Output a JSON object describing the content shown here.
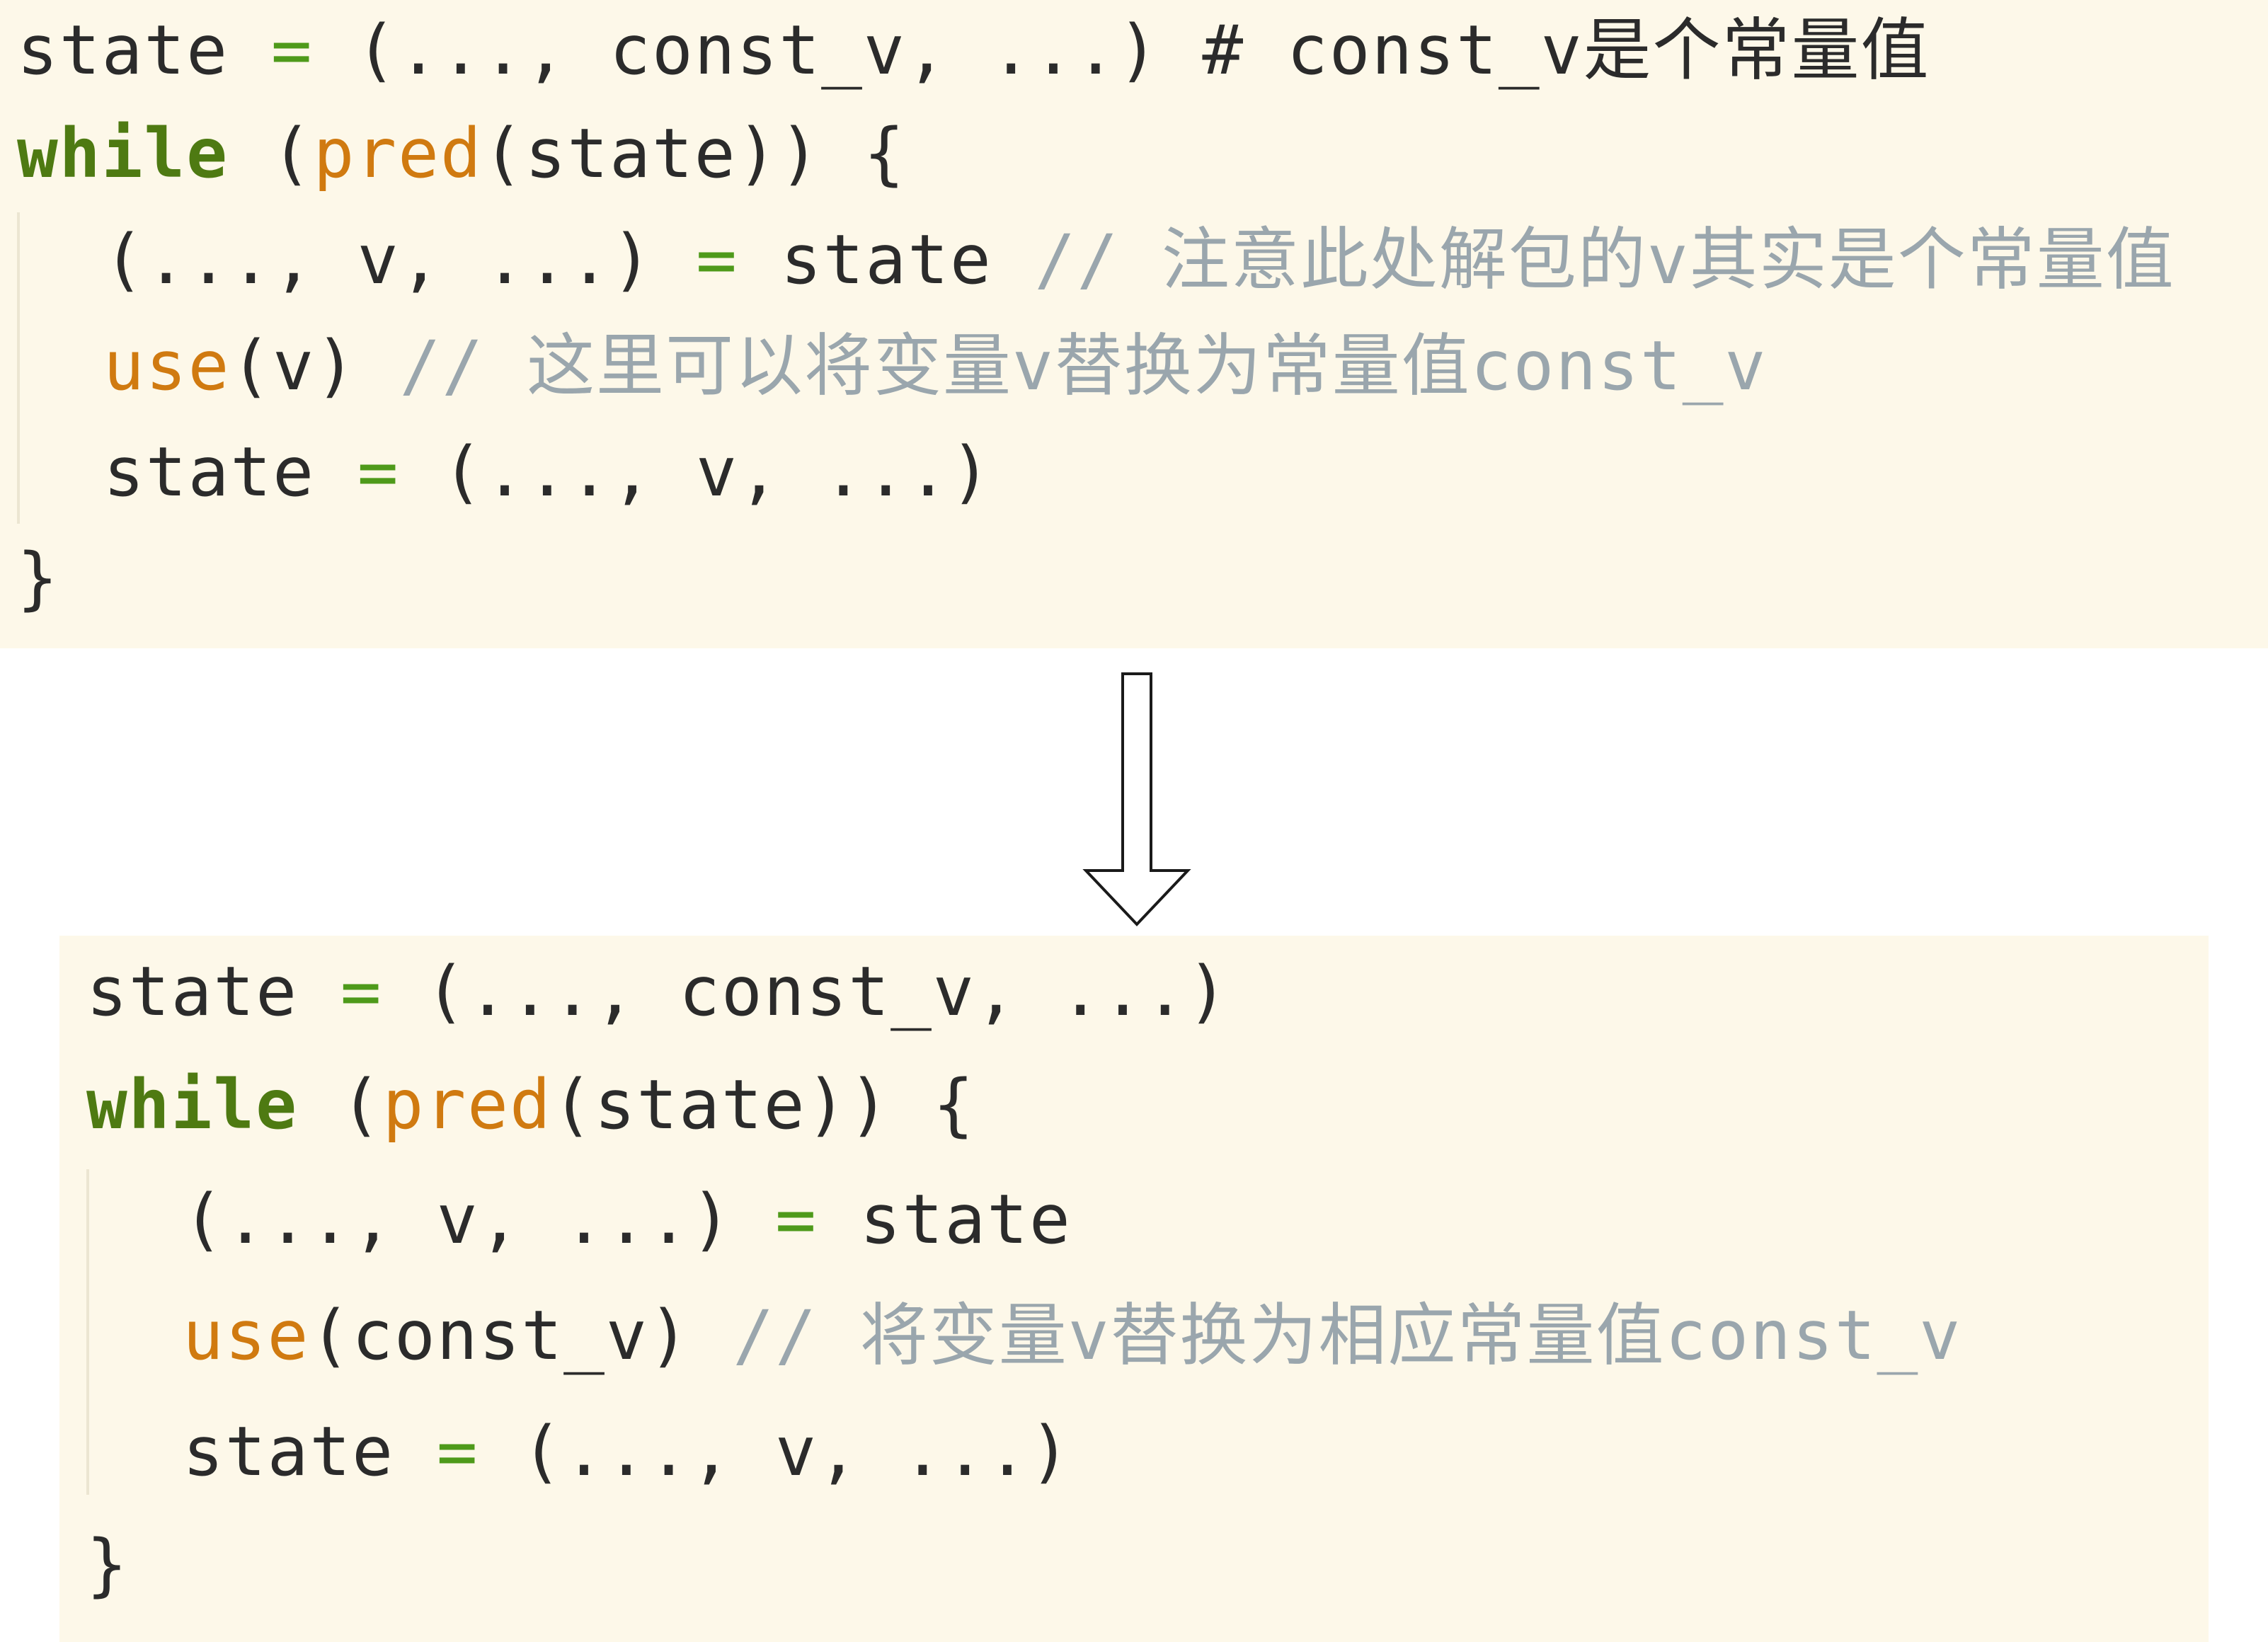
{
  "top_block": {
    "line1": {
      "a": "state",
      "op": "=",
      "b": "(..., const_v, ...)",
      "comment": "# const_v是个常量值"
    },
    "line2": {
      "kw": "while",
      "b1": "(",
      "fn": "pred",
      "b2": "(state)) {"
    },
    "line3": {
      "a": "(..., v, ...)",
      "op": "=",
      "b": "state",
      "comment": "// 注意此处解包的v其实是个常量值"
    },
    "line4": {
      "fn": "use",
      "b": "(v)",
      "comment": "// 这里可以将变量v替换为常量值const_v"
    },
    "line5": {
      "a": "state",
      "op": "=",
      "b": "(..., v, ...)"
    },
    "line6": {
      "a": "}"
    }
  },
  "bottom_block": {
    "line1": {
      "a": "state",
      "op": "=",
      "b": "(..., const_v, ...)"
    },
    "line2": {
      "kw": "while",
      "b1": "(",
      "fn": "pred",
      "b2": "(state)) {"
    },
    "line3": {
      "a": "(..., v, ...)",
      "op": "=",
      "b": "state"
    },
    "line4": {
      "fn": "use",
      "b": "(const_v)",
      "comment": "// 将变量v替换为相应常量值const_v"
    },
    "line5": {
      "a": "state",
      "op": "=",
      "b": "(..., v, ...)"
    },
    "line6": {
      "a": "}"
    }
  },
  "colors": {
    "keyword": "#4e7a12",
    "function": "#d07a10",
    "operator": "#4e9a1a",
    "comment": "#9aa6ad",
    "background": "#fdf8e9"
  }
}
